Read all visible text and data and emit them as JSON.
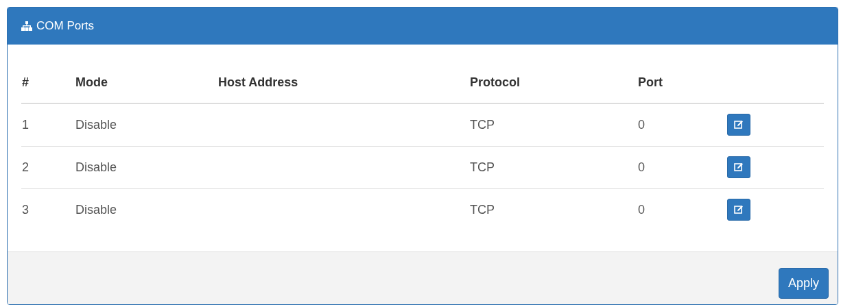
{
  "panel": {
    "title": "COM Ports"
  },
  "table": {
    "columns": [
      "#",
      "Mode",
      "Host Address",
      "Protocol",
      "Port"
    ],
    "rows": [
      {
        "cells": [
          "1",
          "Disable",
          "",
          "TCP",
          "0"
        ]
      },
      {
        "cells": [
          "2",
          "Disable",
          "",
          "TCP",
          "0"
        ]
      },
      {
        "cells": [
          "3",
          "Disable",
          "",
          "TCP",
          "0"
        ]
      }
    ]
  },
  "footer": {
    "buttons": [
      "Apply"
    ]
  }
}
